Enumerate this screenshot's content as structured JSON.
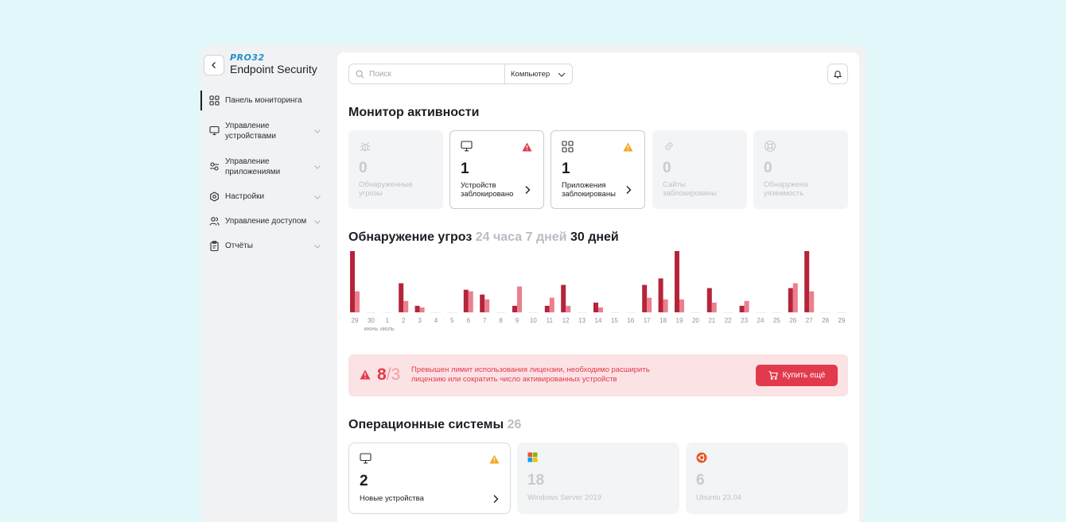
{
  "brand": {
    "logo": "PRO32",
    "product": "Endpoint Security"
  },
  "sidebar": {
    "items": [
      {
        "label": "Панель мониторинга",
        "icon": "grid-icon",
        "active": true
      },
      {
        "label": "Управление устройствами",
        "icon": "monitor-icon"
      },
      {
        "label": "Управление приложениями",
        "icon": "sliders-icon"
      },
      {
        "label": "Настройки",
        "icon": "gear-icon"
      },
      {
        "label": "Управление доступом",
        "icon": "users-icon"
      },
      {
        "label": "Отчёты",
        "icon": "clipboard-icon"
      }
    ]
  },
  "search": {
    "placeholder": "Поиск",
    "scope": "Компьютер"
  },
  "activity": {
    "title": "Монитор активности",
    "cards": [
      {
        "icon": "bug-icon",
        "value": "0",
        "label": "Обнаруженные угрозы",
        "active": false
      },
      {
        "icon": "monitor-icon",
        "value": "1",
        "label": "Устройств заблокировано",
        "active": true,
        "alert": "red"
      },
      {
        "icon": "apps-icon",
        "value": "1",
        "label": "Приложения заблокированы",
        "active": true,
        "alert": "orange"
      },
      {
        "icon": "link-icon",
        "value": "0",
        "label": "Сайты заблокированы",
        "active": false
      },
      {
        "icon": "lifebuoy-icon",
        "value": "0",
        "label": "Обнаружена уязвимость",
        "active": false
      }
    ]
  },
  "threats": {
    "title": "Обнаружение угроз",
    "periods": [
      "24 часа",
      "7 дней",
      "30 дней"
    ],
    "selected_period": "30 дней"
  },
  "chart_data": {
    "type": "bar",
    "categories": [
      "29",
      "30",
      "1",
      "2",
      "3",
      "4",
      "5",
      "6",
      "7",
      "8",
      "9",
      "10",
      "11",
      "12",
      "13",
      "14",
      "15",
      "16",
      "17",
      "18",
      "19",
      "20",
      "21",
      "22",
      "23",
      "24",
      "25",
      "26",
      "27",
      "28",
      "29"
    ],
    "month_labels": [
      "июнь",
      "июль"
    ],
    "series": [
      {
        "color": "#b5243a",
        "values": [
          19,
          0,
          0,
          9,
          2,
          0,
          0,
          7,
          5.5,
          0,
          2,
          0,
          2,
          8.5,
          0,
          3,
          0,
          0,
          8.5,
          10.5,
          19,
          0,
          7.5,
          0,
          2,
          0,
          0,
          7.5,
          19,
          0,
          0
        ]
      },
      {
        "color": "#ec7f8d",
        "values": [
          6.5,
          0,
          0,
          3.5,
          1.5,
          0,
          0,
          6.5,
          4,
          0,
          8,
          0,
          4.5,
          2,
          0,
          1.5,
          0,
          0,
          4.5,
          4,
          4,
          0,
          3,
          0,
          3.5,
          0,
          0,
          9,
          6.5,
          0,
          0
        ]
      }
    ],
    "ylim": [
      0,
      19
    ]
  },
  "license": {
    "used": "8",
    "limit": "/3",
    "message": "Превышен лимит использования лицензии, необходимо расширить лицензию или сократить число активированных устройств",
    "button": "Купить ещё"
  },
  "os": {
    "title": "Операционные системы",
    "count": "26",
    "cards": [
      {
        "icon": "monitor-icon",
        "value": "2",
        "label": "Новые устройства",
        "active": true
      },
      {
        "icon": "windows-icon",
        "value": "18",
        "label": "Windows Server 2019",
        "active": false
      },
      {
        "icon": "ubuntu-icon",
        "value": "6",
        "label": "Ubuntu 23.04",
        "active": false
      }
    ]
  },
  "colors": {
    "accent": "#e23a4c",
    "bar_dark": "#b5243a",
    "bar_light": "#ec7f8d",
    "warning": "#f5a623"
  }
}
